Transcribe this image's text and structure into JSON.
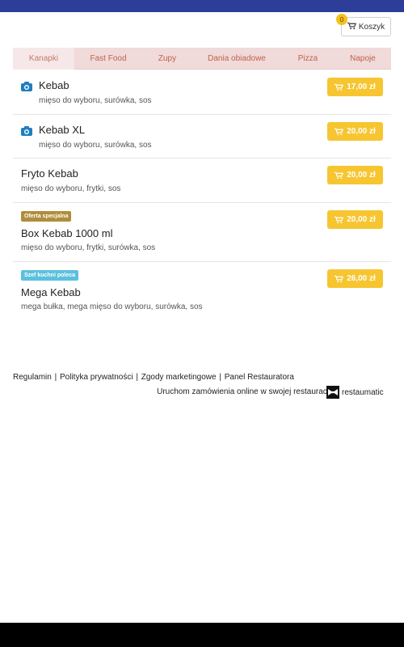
{
  "cart": {
    "label": "Koszyk",
    "count": "0"
  },
  "tabs": [
    {
      "label": "Kanapki"
    },
    {
      "label": "Fast Food"
    },
    {
      "label": "Zupy"
    },
    {
      "label": "Dania obiadowe"
    },
    {
      "label": "Pizza"
    },
    {
      "label": "Napoje"
    }
  ],
  "items": [
    {
      "name": "Kebab",
      "desc": "mięso do wyboru, surówka, sos",
      "price": "17,00 zł"
    },
    {
      "name": "Kebab XL",
      "desc": "mięso do wyboru, surówka, sos",
      "price": "20,00 zł"
    },
    {
      "name": "Fryto Kebab",
      "desc": "mięso do wyboru, frytki, sos",
      "price": "20,00 zł"
    },
    {
      "name": "Box Kebab 1000 ml",
      "desc": "mięso do wyboru, frytki, surówka, sos",
      "price": "20,00 zł",
      "badge": "Oferta specjalna"
    },
    {
      "name": "Mega Kebab",
      "desc": "mega bułka, mega mięso do wyboru, surówka, sos",
      "price": "26,00 zł",
      "badge": "Szef kuchni poleca"
    }
  ],
  "footer": {
    "links": [
      "Regulamin",
      "Polityka prywatności",
      "Zgody marketingowe",
      "Panel Restauratora"
    ],
    "separator": "|",
    "promo": "Uruchom zamówienia online w swojej restauracji!",
    "logo_text": "restaumatic"
  },
  "colors": {
    "top_bar": "#2c3e97",
    "price_button": "#f6c530",
    "tab_text": "#c0624a",
    "badge_special": "#b08d3a",
    "badge_chef": "#5bc0de",
    "camera_icon": "#1f7fbf"
  },
  "icons": {
    "cart": "shopping-cart-icon",
    "photo": "camera-icon",
    "logo": "bowtie-icon"
  }
}
